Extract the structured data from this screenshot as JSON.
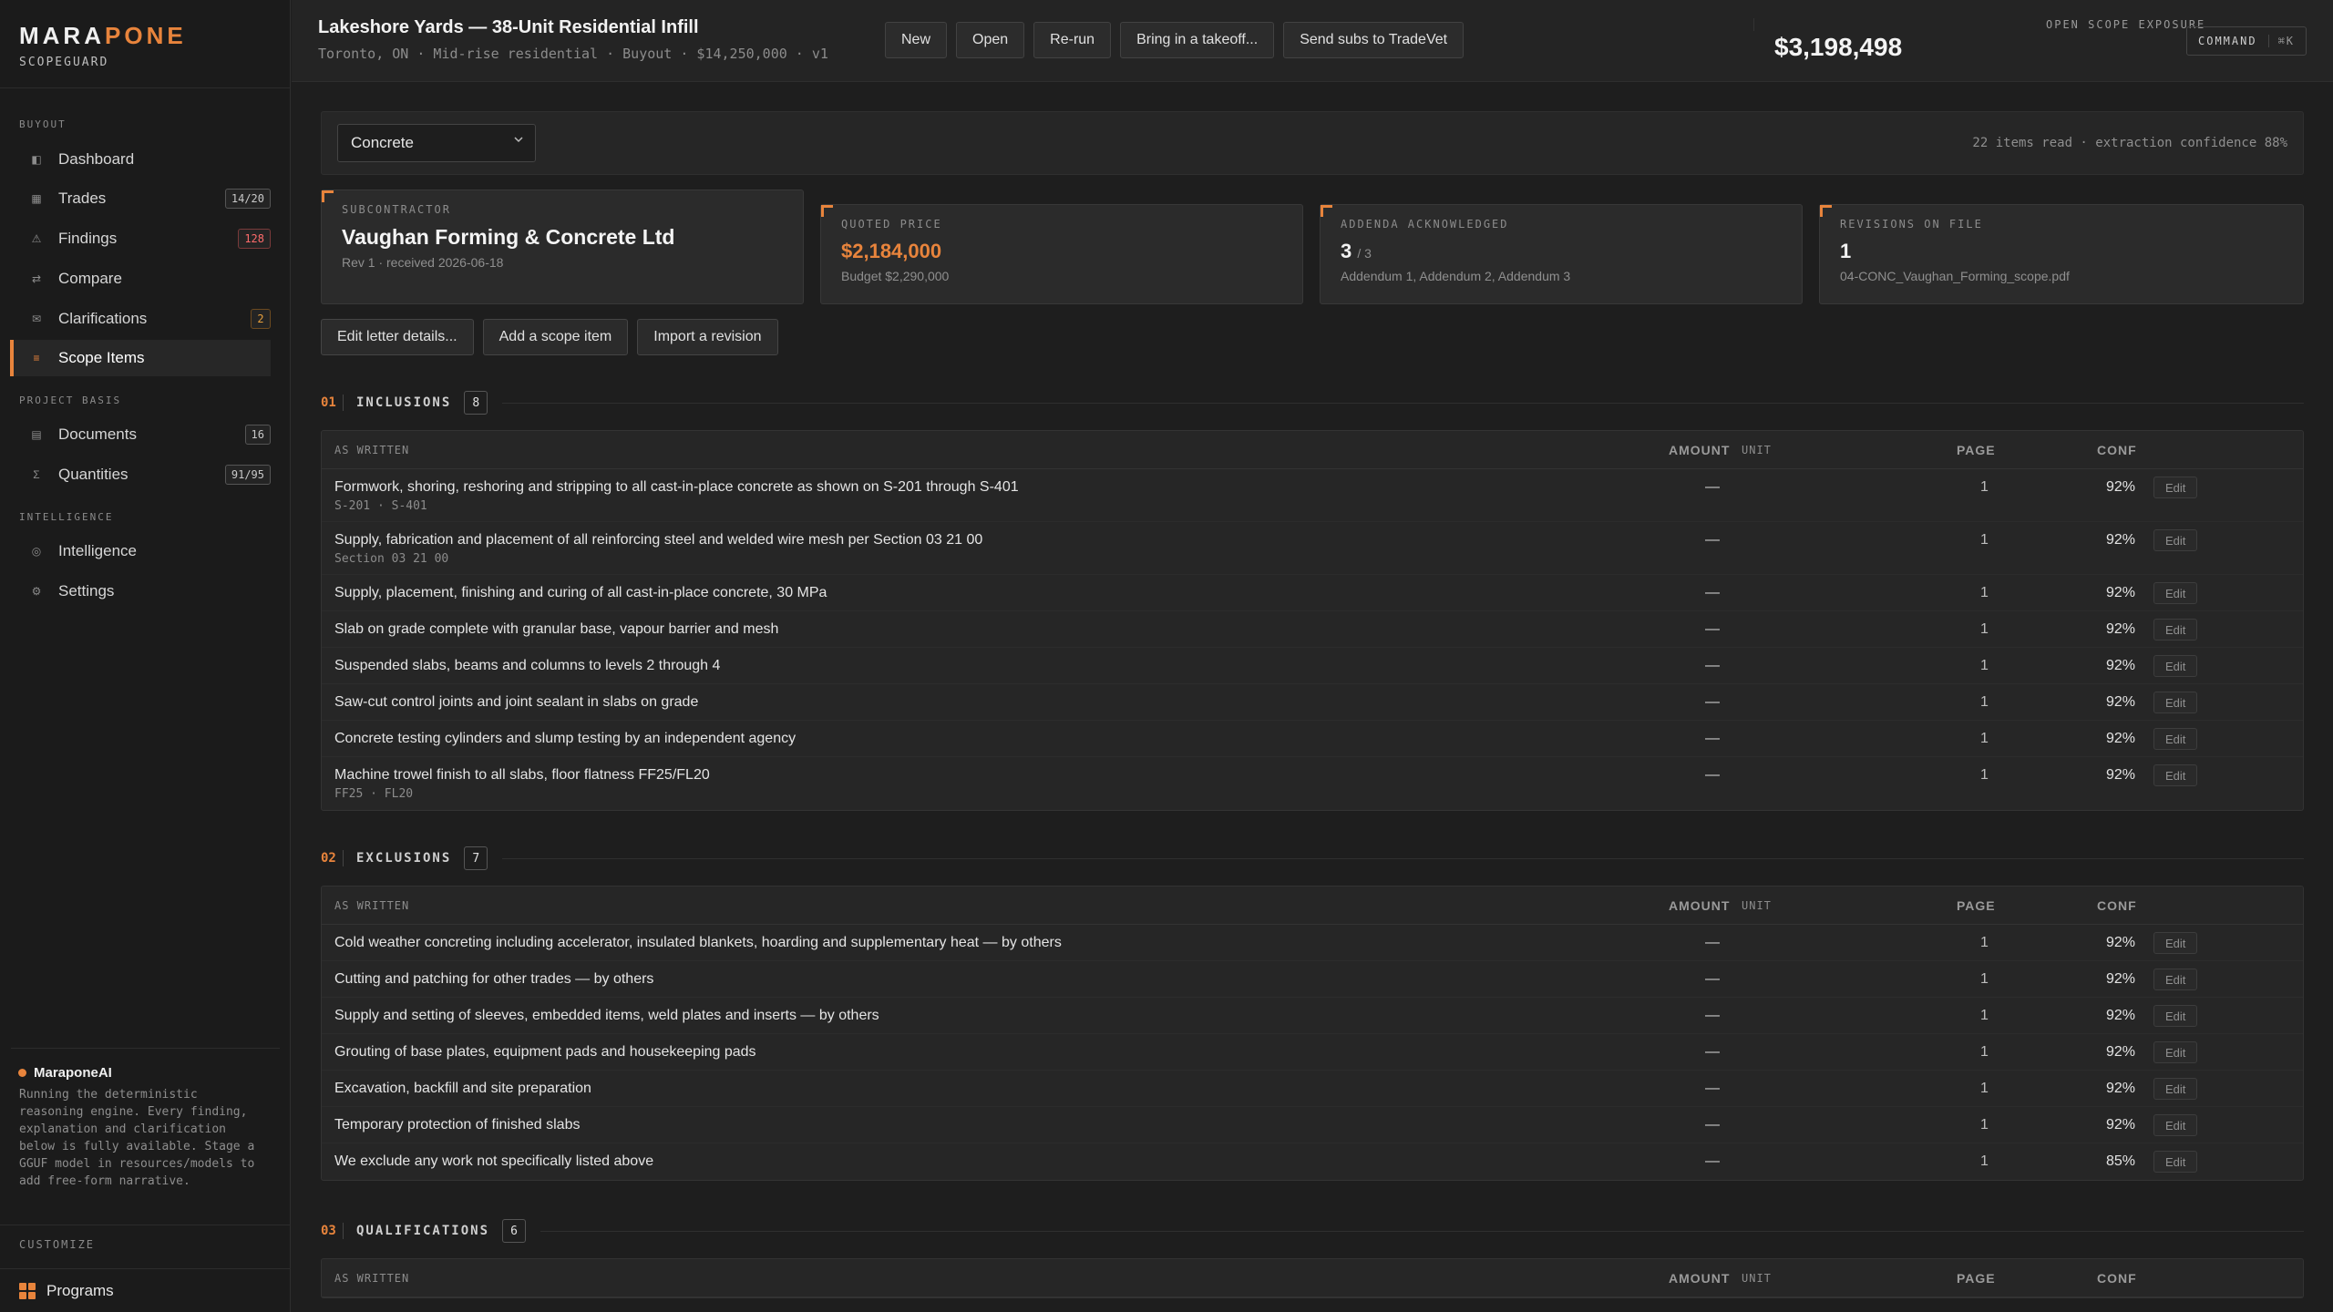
{
  "brand": {
    "name_a": "MARA",
    "name_b": "PONE",
    "sub": "SCOPEGUARD"
  },
  "nav": {
    "sections": [
      "BUYOUT",
      "PROJECT BASIS",
      "INTELLIGENCE"
    ],
    "items": [
      {
        "label": "Dashboard",
        "icon": "dashboard-icon",
        "badge": ""
      },
      {
        "label": "Trades",
        "icon": "trades-icon",
        "badge": "14/20"
      },
      {
        "label": "Findings",
        "icon": "warning-icon",
        "badge": "128"
      },
      {
        "label": "Compare",
        "icon": "compare-icon",
        "badge": ""
      },
      {
        "label": "Clarifications",
        "icon": "mail-icon",
        "badge": "2"
      },
      {
        "label": "Scope Items",
        "icon": "list-icon",
        "badge": ""
      },
      {
        "label": "Documents",
        "icon": "document-icon",
        "badge": "16"
      },
      {
        "label": "Quantities",
        "icon": "sigma-icon",
        "badge": "91/95"
      },
      {
        "label": "Intelligence",
        "icon": "intelligence-icon",
        "badge": ""
      },
      {
        "label": "Settings",
        "icon": "gear-icon",
        "badge": ""
      }
    ]
  },
  "ai": {
    "title": "MaraponeAI",
    "text": "Running the deterministic reasoning engine. Every finding, explanation and clarification below is fully available. Stage a GGUF model in resources/models to add free-form narrative."
  },
  "customize": "CUSTOMIZE",
  "programs": "Programs",
  "header": {
    "title": "Lakeshore Yards — 38-Unit Residential Infill",
    "meta": "Toronto, ON · Mid-rise residential · Buyout · $14,250,000 · v1",
    "buttons": [
      "New",
      "Open",
      "Re-run",
      "Bring in a takeoff...",
      "Send subs to TradeVet"
    ],
    "exposure_label": "OPEN SCOPE EXPOSURE",
    "exposure_value": "$3,198,498",
    "command_label": "COMMAND",
    "command_key": "⌘K"
  },
  "filter": {
    "trade": "Concrete",
    "meta": "22 items read · extraction confidence 88%"
  },
  "cards": {
    "sub_label": "SUBCONTRACTOR",
    "sub_name": "Vaughan Forming & Concrete Ltd",
    "sub_meta": "Rev 1 · received 2026-06-18",
    "price_label": "QUOTED PRICE",
    "price_value": "$2,184,000",
    "price_budget": "Budget $2,290,000",
    "addenda_label": "ADDENDA ACKNOWLEDGED",
    "addenda_value": "3",
    "addenda_total": "/ 3",
    "addenda_list": "Addendum 1, Addendum 2, Addendum 3",
    "rev_label": "REVISIONS ON FILE",
    "rev_value": "1",
    "rev_file": "04-CONC_Vaughan_Forming_scope.pdf"
  },
  "actions": [
    "Edit letter details...",
    "Add a scope item",
    "Import a revision"
  ],
  "columns": {
    "written": "AS WRITTEN",
    "amount": "AMOUNT",
    "unit": "UNIT",
    "page": "PAGE",
    "conf": "CONF",
    "edit": "Edit"
  },
  "sections": [
    {
      "num": "01",
      "title": "INCLUSIONS",
      "count": "8",
      "rows": [
        {
          "text": "Formwork, shoring, reshoring and stripping to all cast-in-place concrete as shown on S-201 through S-401",
          "ref": "S-201 · S-401",
          "amount": "—",
          "page": "1",
          "conf": "92%"
        },
        {
          "text": "Supply, fabrication and placement of all reinforcing steel and welded wire mesh per Section 03 21 00",
          "ref": "Section 03 21 00",
          "amount": "—",
          "page": "1",
          "conf": "92%"
        },
        {
          "text": "Supply, placement, finishing and curing of all cast-in-place concrete, 30 MPa",
          "ref": "",
          "amount": "—",
          "page": "1",
          "conf": "92%"
        },
        {
          "text": "Slab on grade complete with granular base, vapour barrier and mesh",
          "ref": "",
          "amount": "—",
          "page": "1",
          "conf": "92%"
        },
        {
          "text": "Suspended slabs, beams and columns to levels 2 through 4",
          "ref": "",
          "amount": "—",
          "page": "1",
          "conf": "92%"
        },
        {
          "text": "Saw-cut control joints and joint sealant in slabs on grade",
          "ref": "",
          "amount": "—",
          "page": "1",
          "conf": "92%"
        },
        {
          "text": "Concrete testing cylinders and slump testing by an independent agency",
          "ref": "",
          "amount": "—",
          "page": "1",
          "conf": "92%"
        },
        {
          "text": "Machine trowel finish to all slabs, floor flatness FF25/FL20",
          "ref": "FF25 · FL20",
          "amount": "—",
          "page": "1",
          "conf": "92%"
        }
      ]
    },
    {
      "num": "02",
      "title": "EXCLUSIONS",
      "count": "7",
      "rows": [
        {
          "text": "Cold weather concreting including accelerator, insulated blankets, hoarding and supplementary heat — by others",
          "ref": "",
          "amount": "—",
          "page": "1",
          "conf": "92%"
        },
        {
          "text": "Cutting and patching for other trades — by others",
          "ref": "",
          "amount": "—",
          "page": "1",
          "conf": "92%"
        },
        {
          "text": "Supply and setting of sleeves, embedded items, weld plates and inserts — by others",
          "ref": "",
          "amount": "—",
          "page": "1",
          "conf": "92%"
        },
        {
          "text": "Grouting of base plates, equipment pads and housekeeping pads",
          "ref": "",
          "amount": "—",
          "page": "1",
          "conf": "92%"
        },
        {
          "text": "Excavation, backfill and site preparation",
          "ref": "",
          "amount": "—",
          "page": "1",
          "conf": "92%"
        },
        {
          "text": "Temporary protection of finished slabs",
          "ref": "",
          "amount": "—",
          "page": "1",
          "conf": "92%"
        },
        {
          "text": "We exclude any work not specifically listed above",
          "ref": "",
          "amount": "—",
          "page": "1",
          "conf": "85%"
        }
      ]
    },
    {
      "num": "03",
      "title": "QUALIFICATIONS",
      "count": "6",
      "rows": []
    }
  ],
  "colors": {
    "accent": "#e8843c",
    "background": "#1e1e1e",
    "danger": "#ff6b6b"
  }
}
